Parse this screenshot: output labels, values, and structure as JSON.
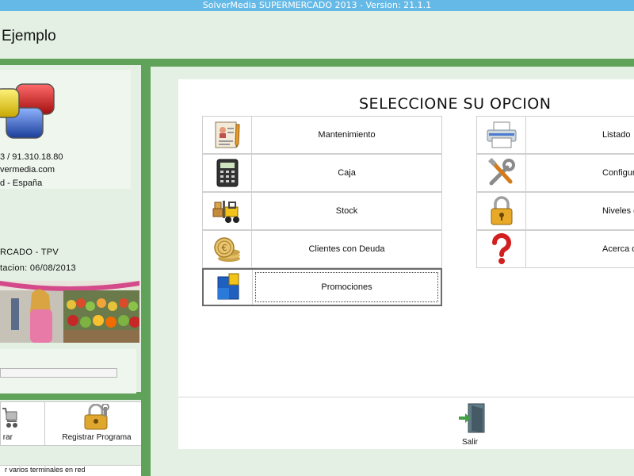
{
  "window": {
    "title": "SolverMedia SUPERMERCADO 2013  -  Version: 21.1.1"
  },
  "app": {
    "title": "Ejemplo"
  },
  "company": {
    "phone": "3 / 91.310.18.80",
    "web": "vermedia.com",
    "location": "d - España"
  },
  "product": {
    "name": "RCADO  -  TPV",
    "activation": "tacion:  06/08/2013"
  },
  "progress": {
    "fraction": 0.0
  },
  "bottom_buttons": [
    {
      "label": "rar",
      "icon": "cart-icon"
    },
    {
      "label": "Registrar Programa",
      "icon": "lock-icon"
    }
  ],
  "status": {
    "text": "r varios terminales en red"
  },
  "menu": {
    "title": "SELECCIONE SU OPCION",
    "left": [
      {
        "label": "Mantenimiento",
        "icon": "document-icon"
      },
      {
        "label": "Caja",
        "icon": "calculator-icon"
      },
      {
        "label": "Stock",
        "icon": "forklift-icon"
      },
      {
        "label": "Clientes con Deuda",
        "icon": "coins-icon"
      },
      {
        "label": "Promociones",
        "icon": "promotions-icon"
      }
    ],
    "right": [
      {
        "label": "Listado",
        "icon": "printer-icon"
      },
      {
        "label": "Configura",
        "icon": "tools-icon"
      },
      {
        "label": "Niveles de A",
        "icon": "padlock-icon"
      },
      {
        "label": "Acerca d",
        "icon": "question-icon"
      }
    ],
    "exit": {
      "label": "Salir",
      "icon": "exit-door-icon"
    }
  },
  "colors": {
    "frame": "#61a25b",
    "background": "#e3f0e3",
    "titlebar": "#65b9e6"
  }
}
